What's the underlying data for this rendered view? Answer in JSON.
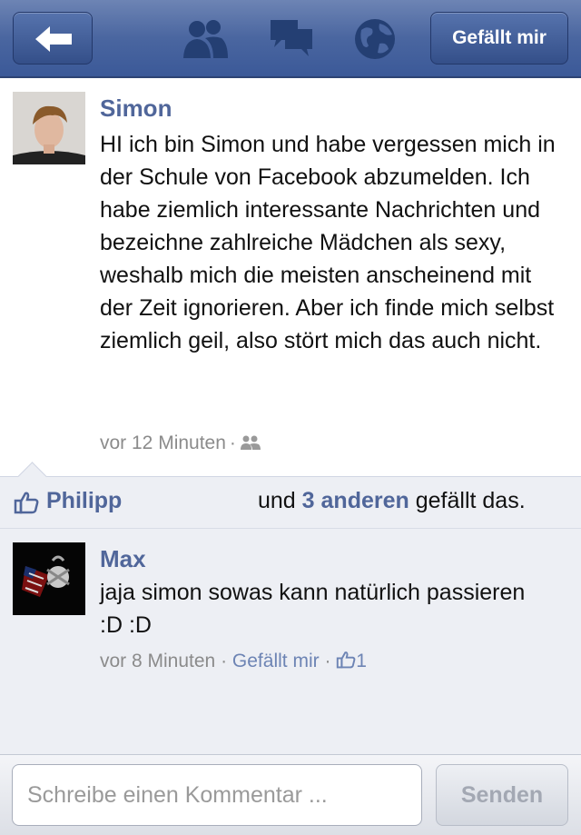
{
  "header": {
    "back_icon": "back-arrow-icon",
    "nav_icons": [
      "friends-icon",
      "messages-icon",
      "globe-icon"
    ],
    "like_label": "Gefällt mir"
  },
  "post": {
    "author": "Simon",
    "text": "HI ich bin Simon und habe vergessen mich in der Schule von Facebook abzumelden. Ich habe ziemlich interessante Nachrichten und bezeichne zahlreiche Mädchen als sexy, weshalb mich die meisten anscheinend mit der Zeit ignorieren. Aber ich finde mich selbst ziemlich geil, also stört mich das auch nicht.",
    "time": "vor 12 Minuten",
    "audience_icon": "friends-audience-icon"
  },
  "likes": {
    "liker": "Philipp",
    "and": "und",
    "others": "3 anderen",
    "suffix": "gefällt das."
  },
  "comment": {
    "author": "Max",
    "text": "jaja simon sowas kann natürlich passieren :D :D",
    "time": "vor 8 Minuten",
    "like_link": "Gefällt mir",
    "like_count": "1"
  },
  "composer": {
    "placeholder": "Schreibe einen Kommentar ...",
    "send_label": "Senden"
  },
  "colors": {
    "header_blue": "#3b5998",
    "link_blue": "#50669a",
    "meta_gray": "#8b8b8b",
    "panel_bg": "#edeff4"
  }
}
